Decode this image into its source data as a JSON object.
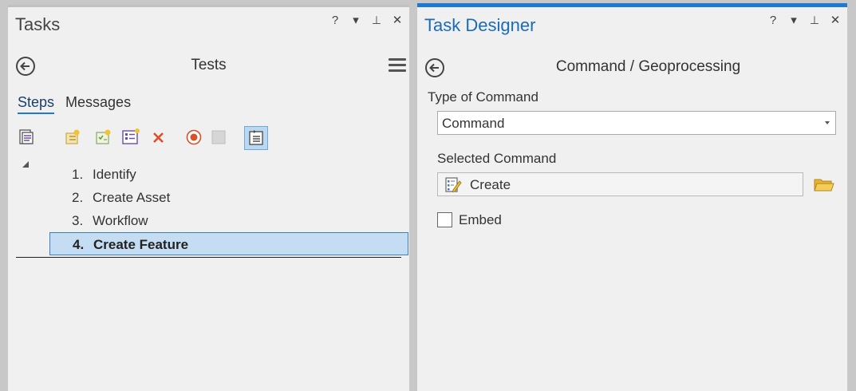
{
  "tasks_pane": {
    "title": "Tasks",
    "header_controls": {
      "help": "?",
      "options": "▾",
      "pin": "⊥",
      "close": "✕"
    },
    "task_name": "Tests",
    "tabs": [
      {
        "label": "Steps",
        "active": true
      },
      {
        "label": "Messages",
        "active": false
      }
    ],
    "toolbar_icons": [
      "task-properties-icon",
      "new-group-icon",
      "new-step-icon",
      "step-properties-icon",
      "delete-icon",
      "record-icon",
      "stop-icon",
      "task-designer-icon"
    ],
    "steps": [
      {
        "num": "1.",
        "label": "Identify",
        "selected": false
      },
      {
        "num": "2.",
        "label": "Create Asset",
        "selected": false
      },
      {
        "num": "3.",
        "label": "Workflow",
        "selected": false
      },
      {
        "num": "4.",
        "label": "Create Feature",
        "selected": true
      }
    ]
  },
  "designer_pane": {
    "title": "Task Designer",
    "header_controls": {
      "help": "?",
      "options": "▾",
      "pin": "⊥",
      "close": "✕"
    },
    "section_title": "Command / Geoprocessing",
    "type_label": "Type of Command",
    "type_value": "Command",
    "selected_label": "Selected Command",
    "selected_value": "Create",
    "embed_label": "Embed",
    "embed_checked": false
  },
  "colors": {
    "accent": "#1c7ad4",
    "selection_bg": "#c5ddf3",
    "delete_red": "#d9502a",
    "record_red": "#d9502a",
    "folder_yellow": "#e8b330"
  }
}
